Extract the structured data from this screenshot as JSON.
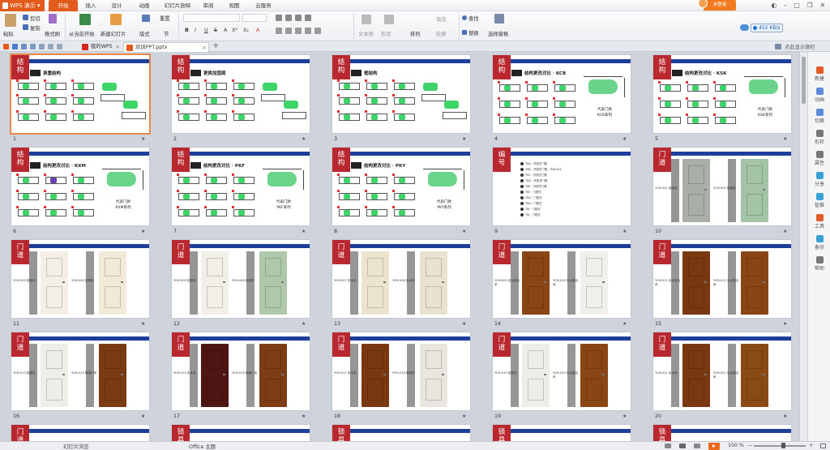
{
  "menubar": {
    "app_name": "WPS 演示",
    "tabs": [
      "开始",
      "插入",
      "设计",
      "动画",
      "幻灯片放映",
      "审阅",
      "视图",
      "云服务"
    ],
    "active_tab": "开始",
    "login_label": "未登录"
  },
  "ribbon": {
    "paste": "粘贴",
    "cut": "剪切",
    "copy": "复制",
    "format_painter": "格式刷",
    "from_current": "从当前开始",
    "new_slide": "新建幻灯片",
    "layout": "版式",
    "section": "节",
    "reset": "重置",
    "text_box": "文本框",
    "shape": "形状",
    "arrange": "排列",
    "outline": "轮廓",
    "fill": "填充",
    "find": "查找",
    "replace": "替换",
    "select_pane": "选择窗格",
    "font_buttons": [
      "B",
      "I",
      "U",
      "S",
      "A",
      "X²",
      "X₂",
      "A"
    ],
    "net_speed": "452 KB/s"
  },
  "tabbar": {
    "tabs": [
      {
        "label": "我的WPS",
        "active": false
      },
      {
        "label": "培训PPT.pptx",
        "active": true
      }
    ],
    "new_tab": "+",
    "sidebar_toggle": "点此显示侧栏"
  },
  "slides": [
    {
      "num": "1",
      "tag": "结构",
      "title": "承重结构",
      "kind": "diagram",
      "selected": true
    },
    {
      "num": "2",
      "tag": "结构",
      "title": "更换加固局",
      "kind": "diagram"
    },
    {
      "num": "3",
      "tag": "结构",
      "title": "框结构",
      "kind": "diagram"
    },
    {
      "num": "4",
      "tag": "结构",
      "title": "结构更改对比 · KCB",
      "kind": "diagram2",
      "product_label": "代表门款",
      "series_label": "KCB系列"
    },
    {
      "num": "5",
      "tag": "结构",
      "title": "结构更改对比 · KSK",
      "kind": "diagram2",
      "product_label": "代表门款",
      "series_label": "KSK系列"
    },
    {
      "num": "6",
      "tag": "结构",
      "title": "结构更改对比 · KXM",
      "kind": "diagram2",
      "product_label": "代表门款",
      "series_label": "KXM系列"
    },
    {
      "num": "7",
      "tag": "结构",
      "title": "结构更改对比 · PKF",
      "kind": "diagram2",
      "product_label": "代表门款",
      "series_label": "PKF系列"
    },
    {
      "num": "8",
      "tag": "结构",
      "title": "结构更改对比 · PKY",
      "kind": "diagram2",
      "product_label": "代表门款",
      "series_label": "PKY系列"
    },
    {
      "num": "9",
      "tag": "编号",
      "title": "",
      "kind": "codes",
      "codes": [
        "TKA：开放式门框",
        "TKB：开放式门框，TKB-002",
        "TKC：开放式门框",
        "TKD：开放式门框",
        "TKE：开放式门框",
        "TKF：门框式",
        "TKG：门框式",
        "TKH：门框式",
        "TKI：门框式",
        "TKJ：门框式"
      ]
    },
    {
      "num": "10",
      "tag": "门道",
      "kind": "doors",
      "doors": [
        "#a9aea6",
        "#a4c4a7"
      ],
      "captions": [
        "YCM-001 铝框系",
        "YCM-002 铝框系"
      ]
    },
    {
      "num": "11",
      "tag": "门道",
      "kind": "doors",
      "doors": [
        "#f3efe4",
        "#f1ead8"
      ],
      "captions": [
        "YCM-003 铝框系",
        "YCM-004 铝框系"
      ]
    },
    {
      "num": "12",
      "tag": "门道",
      "kind": "doors",
      "doors": [
        "#f2efe8",
        "#aec8a9"
      ],
      "captions": [
        "YCM-005 铝框系",
        "YCM-006 铝框系"
      ]
    },
    {
      "num": "13",
      "tag": "门道",
      "kind": "doors",
      "doors": [
        "#ece4cf",
        "#e9e2cf"
      ],
      "captions": [
        "YCM-007 实木系",
        "YCM-008 实木系"
      ]
    },
    {
      "num": "14",
      "tag": "门道",
      "kind": "doors",
      "doors": [
        "#8a4514",
        "#f0efec"
      ],
      "captions": [
        "YCM-009 实木复合系",
        "YCM-010 实木复合系"
      ]
    },
    {
      "num": "15",
      "tag": "门道",
      "kind": "doors",
      "doors": [
        "#7a3810",
        "#8a4514"
      ],
      "captions": [
        "YCM-011 实木复合系",
        "YCM-012 实木复合系"
      ]
    },
    {
      "num": "16",
      "tag": "门道",
      "kind": "doors",
      "doors": [
        "#efede8",
        "#7a3a12"
      ],
      "captions": [
        "YCM-013 铝框系",
        "YCM-014 玻璃门系"
      ]
    },
    {
      "num": "17",
      "tag": "门道",
      "kind": "doors",
      "doors": [
        "#4d1612",
        "#7d3c14"
      ],
      "captions": [
        "YCM-015 实木系",
        "YCM-016 玻璃门系"
      ]
    },
    {
      "num": "18",
      "tag": "门道",
      "kind": "doors",
      "doors": [
        "#7a3810",
        "#e8e6df"
      ],
      "captions": [
        "YCM-017 实木系",
        "YCM-018 铝框系"
      ]
    },
    {
      "num": "19",
      "tag": "门道",
      "kind": "doors",
      "doors": [
        "#efede8",
        "#8a4514"
      ],
      "captions": [
        "YCM-019 铝框系",
        "YCM-020 实木复合系"
      ]
    },
    {
      "num": "20",
      "tag": "门道",
      "kind": "doors",
      "doors": [
        "#7a3810",
        "#8a4a14"
      ],
      "captions": [
        "YCM-021 实木系",
        "YCM-022 实木复合系"
      ]
    },
    {
      "num": "21",
      "tag": "门道",
      "kind": "partial"
    },
    {
      "num": "22",
      "tag": "锁具",
      "kind": "partial"
    },
    {
      "num": "23",
      "tag": "锁具",
      "kind": "partial"
    },
    {
      "num": "24",
      "tag": "锁具",
      "kind": "partial"
    },
    {
      "num": "25",
      "tag": "锁具",
      "kind": "partial"
    }
  ],
  "sidebar": {
    "items": [
      {
        "label": "新建",
        "color": "#e25b2a"
      },
      {
        "label": "动画",
        "color": "#5b8ad8"
      },
      {
        "label": "切换",
        "color": "#5b8ad8"
      },
      {
        "label": "形状",
        "color": "#777777"
      },
      {
        "label": "属性",
        "color": "#777777"
      },
      {
        "label": "分享",
        "color": "#3aa0d6"
      },
      {
        "label": "智推",
        "color": "#3aa0d6"
      },
      {
        "label": "工具",
        "color": "#e25b2a"
      },
      {
        "label": "备份",
        "color": "#3aa0d6"
      },
      {
        "label": "帮助",
        "color": "#777777"
      }
    ]
  },
  "statusbar": {
    "view_name": "幻灯片浏览",
    "theme": "Office 主题",
    "zoom": "100 %",
    "zoom_minus": "—",
    "zoom_plus": "+"
  },
  "colors": {
    "accent": "#e35b1c",
    "slide_blue": "#1d3e9a",
    "slide_red": "#b8282e"
  }
}
